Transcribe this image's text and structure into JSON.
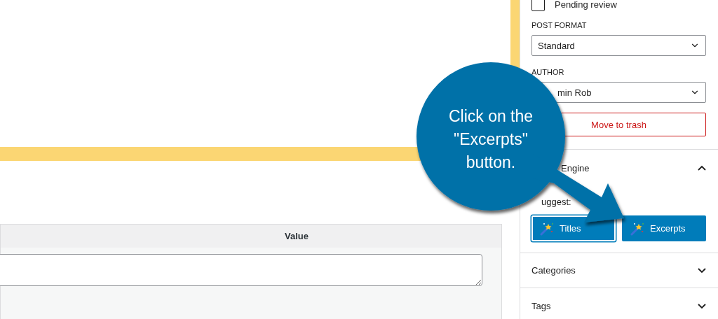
{
  "sidebar": {
    "pending_review": {
      "label": "Pending review",
      "checked": false
    },
    "post_format": {
      "label": "POST FORMAT",
      "value": "Standard"
    },
    "author": {
      "label": "AUTHOR",
      "value": "min Rob"
    },
    "trash_button": "Move to trash",
    "panels": [
      {
        "title": "Engine",
        "expanded": true,
        "suggest_label": "uggest:",
        "buttons": [
          {
            "label": "Titles",
            "focused": true
          },
          {
            "label": "Excerpts",
            "focused": false
          }
        ]
      },
      {
        "title": "Categories",
        "expanded": false
      },
      {
        "title": "Tags",
        "expanded": false
      }
    ]
  },
  "custom_fields": {
    "columns": [
      "Value"
    ]
  },
  "callout": {
    "text": "Click on the\n\"Excerpts\"\nbutton."
  }
}
